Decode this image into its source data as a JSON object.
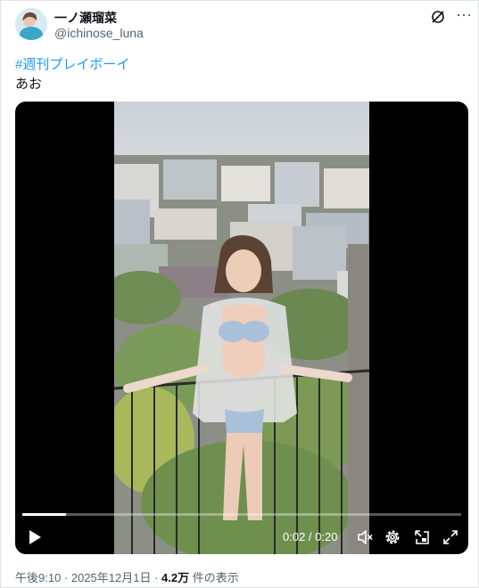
{
  "post": {
    "author_name": "一ノ瀬瑠菜",
    "author_handle": "@ichinose_luna",
    "hashtag": "#週刊プレイボーイ",
    "text": "あお",
    "timestamp": "午後9:10 · 2025年12月1日",
    "views_count": "4.2万",
    "views_label": "件の表示",
    "separator": " · "
  },
  "video": {
    "current_time": "0:02",
    "duration": "0:20",
    "time_divider": " / ",
    "progress": 0.1
  },
  "colors": {
    "link": "#1d9bf0",
    "secondary_text": "#536471",
    "primary_text": "#0f1419"
  },
  "icons": [
    "grok-icon",
    "more-icon",
    "play-icon",
    "volume-mute-icon",
    "settings-icon",
    "pip-icon",
    "fullscreen-icon"
  ]
}
